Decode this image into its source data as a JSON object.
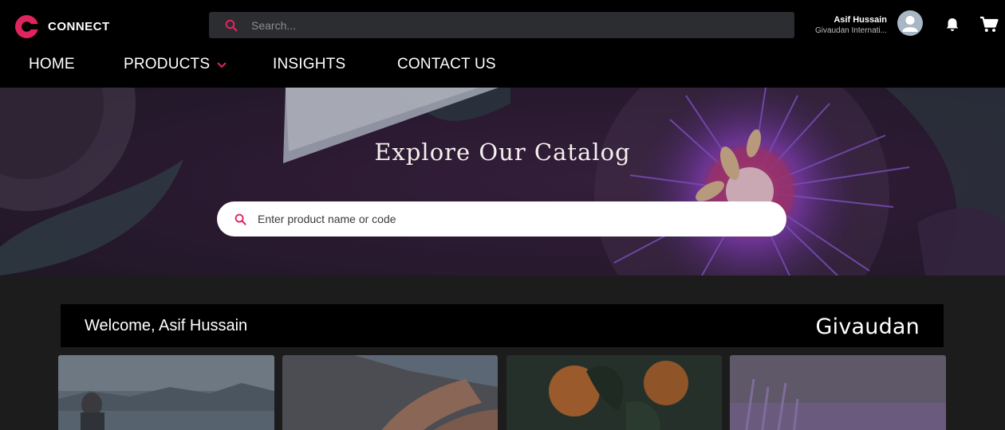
{
  "header": {
    "logo_text": "CONNECT",
    "search_placeholder": "Search...",
    "user_name": "Asif Hussain",
    "user_org": "Givaudan Internati...",
    "icons": [
      "search-icon",
      "user-avatar-icon",
      "bell-icon",
      "cart-icon"
    ]
  },
  "nav": {
    "items": [
      {
        "label": "HOME"
      },
      {
        "label": "PRODUCTS",
        "has_dropdown": true
      },
      {
        "label": "INSIGHTS"
      },
      {
        "label": "CONTACT US"
      }
    ]
  },
  "hero": {
    "title": "Explore Our Catalog",
    "search_placeholder": "Enter product name or code"
  },
  "welcome": {
    "text": "Welcome, Asif Hussain",
    "brand": "Givaudan"
  },
  "cards": [
    {
      "image": "person-by-mountain-lake"
    },
    {
      "image": "hands-applying-lotion"
    },
    {
      "image": "oranges-on-tree"
    },
    {
      "image": "lavender-field"
    }
  ],
  "colors": {
    "accent": "#e0245e",
    "header_bg": "#000000",
    "page_bg": "#1c1c1c",
    "search_bg": "#2b2d30"
  }
}
